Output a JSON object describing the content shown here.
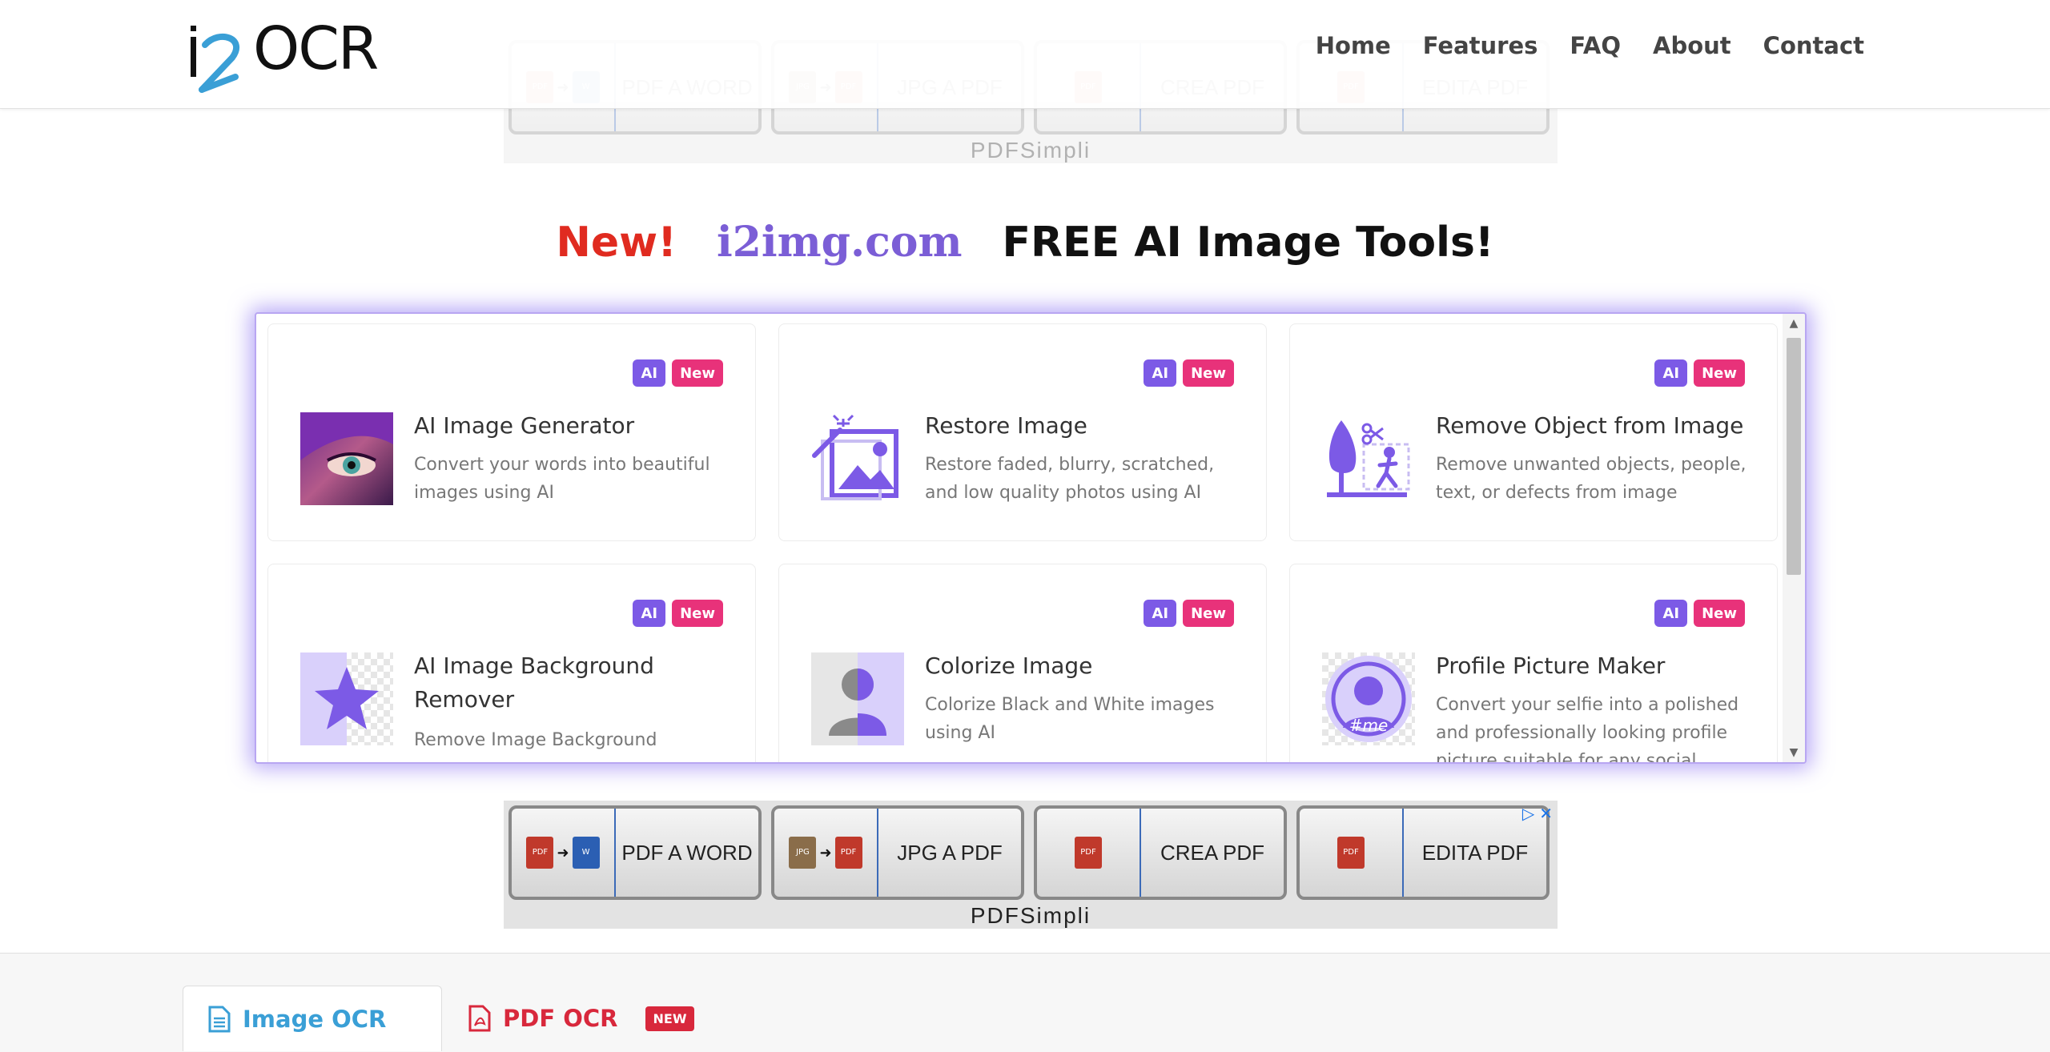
{
  "header": {
    "logo_text": "OCR",
    "nav": [
      "Home",
      "Features",
      "FAQ",
      "About",
      "Contact"
    ]
  },
  "ad": {
    "buttons": [
      "PDF A WORD",
      "JPG A PDF",
      "CREA PDF",
      "EDITA PDF"
    ],
    "brand": "PDFSimpli",
    "chips": {
      "pdf": "PDF",
      "jpg": "JPG"
    }
  },
  "promo": {
    "new": "New!",
    "site": "i2img.com",
    "tagline": "FREE AI Image Tools!"
  },
  "badges": {
    "ai": "AI",
    "new": "New"
  },
  "tools": [
    {
      "title": "AI Image Generator",
      "desc": "Convert your words into beautiful images using AI",
      "icon": "portrait-eye-image"
    },
    {
      "title": "Restore Image",
      "desc": "Restore faded, blurry, scratched, and low quality photos using AI",
      "icon": "magic-wand-photo-icon"
    },
    {
      "title": "Remove Object from Image",
      "desc": "Remove unwanted objects, people, text, or defects from image",
      "icon": "tree-person-scissors-icon"
    },
    {
      "title": "AI Image Background Remover",
      "desc": "Remove Image Background",
      "icon": "star-transparent-icon"
    },
    {
      "title": "Colorize Image",
      "desc": "Colorize Black and White images using AI",
      "icon": "person-half-color-icon"
    },
    {
      "title": "Profile Picture Maker",
      "desc": "Convert your selfie into a polished and professionally looking profile picture suitable for any social profile",
      "icon": "profile-me-icon",
      "icon_text": "#me"
    }
  ],
  "tabs": {
    "image_ocr": "Image OCR",
    "pdf_ocr": "PDF OCR",
    "new_tag": "NEW"
  },
  "colors": {
    "accent_purple": "#7c5ae6",
    "accent_pink": "#e8327a",
    "brand_blue": "#3a9fd6",
    "pdf_red": "#d8283c",
    "promo_red": "#e02b20"
  }
}
